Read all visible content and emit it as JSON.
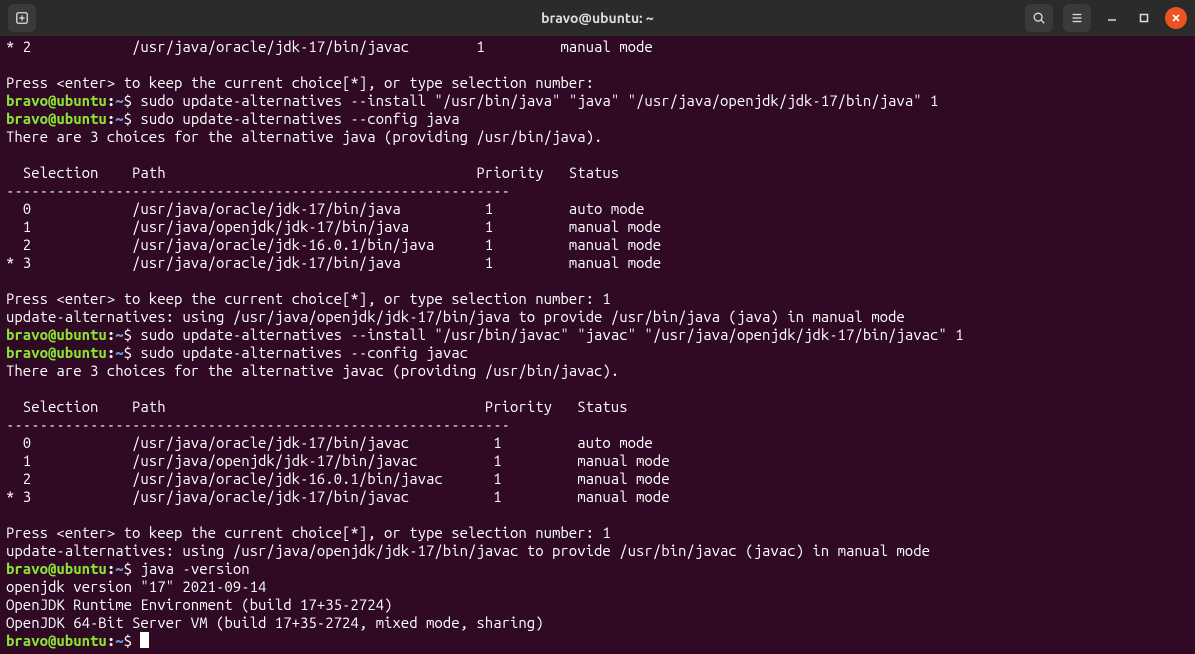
{
  "titlebar": {
    "title": "bravo@ubuntu: ~"
  },
  "prompt": {
    "user_host": "bravo@ubuntu",
    "colon": ":",
    "path": "~",
    "dollar": "$"
  },
  "lines": {
    "l0": "* 2            /usr/java/oracle/jdk-17/bin/javac        1         manual mode",
    "l1": "",
    "l2": "Press <enter> to keep the current choice[*], or type selection number:",
    "cmd1": " sudo update-alternatives --install \"/usr/bin/java\" \"java\" \"/usr/java/openjdk/jdk-17/bin/java\" 1",
    "cmd2": " sudo update-alternatives --config java",
    "l5": "There are 3 choices for the alternative java (providing /usr/bin/java).",
    "l6": "",
    "l7": "  Selection    Path                                     Priority   Status",
    "l8": "------------------------------------------------------------",
    "l9": "  0            /usr/java/oracle/jdk-17/bin/java          1         auto mode",
    "l10": "  1            /usr/java/openjdk/jdk-17/bin/java         1         manual mode",
    "l11": "  2            /usr/java/oracle/jdk-16.0.1/bin/java      1         manual mode",
    "l12": "* 3            /usr/java/oracle/jdk-17/bin/java          1         manual mode",
    "l13": "",
    "l14": "Press <enter> to keep the current choice[*], or type selection number: 1",
    "l15": "update-alternatives: using /usr/java/openjdk/jdk-17/bin/java to provide /usr/bin/java (java) in manual mode",
    "cmd3": " sudo update-alternatives --install \"/usr/bin/javac\" \"javac\" \"/usr/java/openjdk/jdk-17/bin/javac\" 1",
    "cmd4": " sudo update-alternatives --config javac",
    "l18": "There are 3 choices for the alternative javac (providing /usr/bin/javac).",
    "l19": "",
    "l20": "  Selection    Path                                      Priority   Status",
    "l21": "------------------------------------------------------------",
    "l22": "  0            /usr/java/oracle/jdk-17/bin/javac          1         auto mode",
    "l23": "  1            /usr/java/openjdk/jdk-17/bin/javac         1         manual mode",
    "l24": "  2            /usr/java/oracle/jdk-16.0.1/bin/javac      1         manual mode",
    "l25": "* 3            /usr/java/oracle/jdk-17/bin/javac          1         manual mode",
    "l26": "",
    "l27": "Press <enter> to keep the current choice[*], or type selection number: 1",
    "l28": "update-alternatives: using /usr/java/openjdk/jdk-17/bin/javac to provide /usr/bin/javac (javac) in manual mode",
    "cmd5": " java -version",
    "l30": "openjdk version \"17\" 2021-09-14",
    "l31": "OpenJDK Runtime Environment (build 17+35-2724)",
    "l32": "OpenJDK 64-Bit Server VM (build 17+35-2724, mixed mode, sharing)",
    "cmd6": " "
  }
}
